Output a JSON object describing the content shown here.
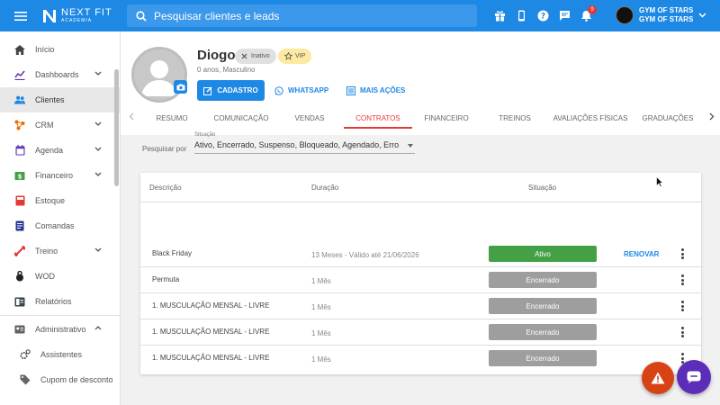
{
  "app": {
    "logo_name": "NEXT FIT",
    "logo_sub": "ACADEMIA"
  },
  "search": {
    "placeholder": "Pesquisar clientes e leads"
  },
  "header": {
    "notification_count": "9",
    "account_line1": "GYM OF STARS",
    "account_line2": "GYM OF STARS"
  },
  "sidebar": {
    "items": [
      {
        "label": "Início",
        "icon": "home-icon"
      },
      {
        "label": "Dashboards",
        "icon": "chart-line-icon"
      },
      {
        "label": "Clientes",
        "icon": "users-icon"
      },
      {
        "label": "CRM",
        "icon": "crm-icon"
      },
      {
        "label": "Agenda",
        "icon": "calendar-icon"
      },
      {
        "label": "Financeiro",
        "icon": "money-icon"
      },
      {
        "label": "Estoque",
        "icon": "box-icon"
      },
      {
        "label": "Comandas",
        "icon": "receipt-icon"
      },
      {
        "label": "Treino",
        "icon": "dumbbell-icon"
      },
      {
        "label": "WOD",
        "icon": "kettlebell-icon"
      },
      {
        "label": "Relatórios",
        "icon": "report-icon"
      },
      {
        "label": "Administrativo",
        "icon": "id-card-icon"
      },
      {
        "label": "Assistentes",
        "icon": "gears-icon"
      },
      {
        "label": "Cupom de desconto",
        "icon": "tag-icon"
      }
    ]
  },
  "profile": {
    "name": "Diogo",
    "inactive_chip": "Inativo",
    "vip_chip": "VIP",
    "subtitle": "0 anos, Masculino",
    "btn_cadastro": "CADASTRO",
    "btn_whatsapp": "WHATSAPP",
    "btn_mais": "MAIS AÇÕES"
  },
  "tabs": [
    "RESUMO",
    "COMUNICAÇÃO",
    "VENDAS",
    "CONTRATOS",
    "FINANCEIRO",
    "TREINOS",
    "AVALIAÇÕES FÍSICAS",
    "GRADUAÇÕES"
  ],
  "filter": {
    "label": "Pesquisar por",
    "caption": "Situação",
    "value": "Ativo, Encerrado, Suspenso, Bloqueado, Agendado, Erro"
  },
  "table": {
    "headers": {
      "descricao": "Descrição",
      "duracao": "Duração",
      "situacao": "Situação"
    },
    "renew_label": "RENOVAR",
    "rows": [
      {
        "descricao": "Black Friday",
        "duracao": "13 Meses - Válido até 21/06/2026",
        "situacao": "Ativo"
      },
      {
        "descricao": "Permuta",
        "duracao": "1 Mês",
        "situacao": "Encerrado"
      },
      {
        "descricao": "1. MUSCULAÇÃO MENSAL - LIVRE",
        "duracao": "1 Mês",
        "situacao": "Encerrado"
      },
      {
        "descricao": "1. MUSCULAÇÃO MENSAL - LIVRE",
        "duracao": "1 Mês",
        "situacao": "Encerrado"
      },
      {
        "descricao": "1. MUSCULAÇÃO MENSAL - LIVRE",
        "duracao": "1 Mês",
        "situacao": "Encerrado"
      }
    ]
  },
  "colors": {
    "primary": "#1e88e5",
    "active_status": "#43a047",
    "closed_status": "#9e9e9e",
    "tab_active": "#e53935",
    "fab_warning": "#d84315",
    "fab_chat": "#5c2db8"
  }
}
